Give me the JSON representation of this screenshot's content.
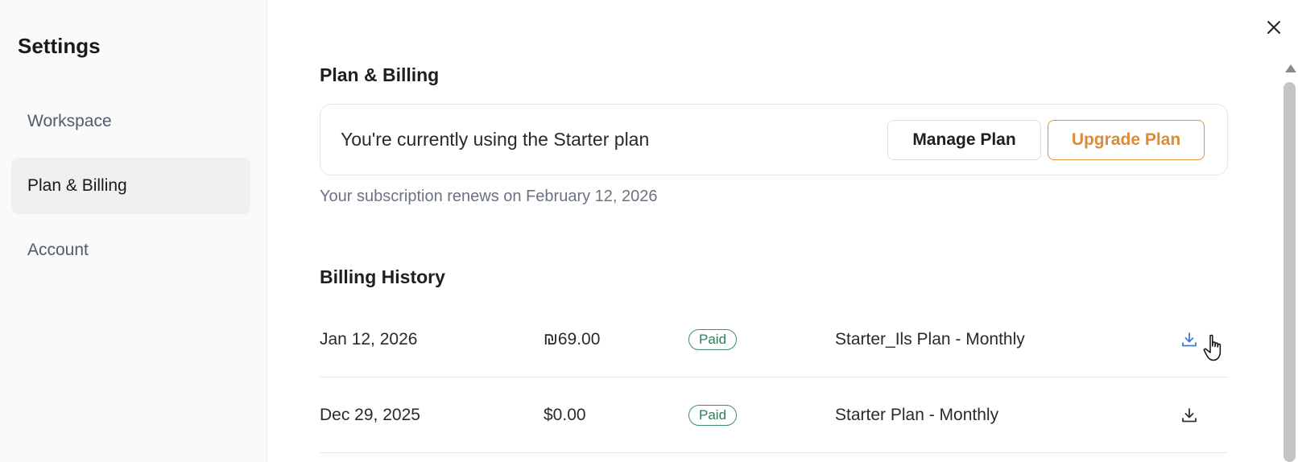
{
  "sidebar": {
    "title": "Settings",
    "items": [
      {
        "label": "Workspace",
        "active": false
      },
      {
        "label": "Plan & Billing",
        "active": true
      },
      {
        "label": "Account",
        "active": false
      }
    ]
  },
  "header": {
    "close_icon": "close-icon"
  },
  "plan": {
    "section_title": "Plan & Billing",
    "current_plan_text": "You're currently using the Starter plan",
    "manage_label": "Manage Plan",
    "upgrade_label": "Upgrade Plan",
    "renew_text": "Your subscription renews on February 12, 2026"
  },
  "billing": {
    "section_title": "Billing History",
    "rows": [
      {
        "date": "Jan 12, 2026",
        "amount": "₪69.00",
        "status": "Paid",
        "plan": "Starter_Ils Plan - Monthly",
        "icon": "download-icon"
      },
      {
        "date": "Dec 29, 2025",
        "amount": "$0.00",
        "status": "Paid",
        "plan": "Starter Plan - Monthly",
        "icon": "download-icon"
      }
    ]
  },
  "colors": {
    "accent_orange": "#df8a35",
    "paid_green": "#2f7d57",
    "active_nav_bg": "#f0f0f0"
  }
}
